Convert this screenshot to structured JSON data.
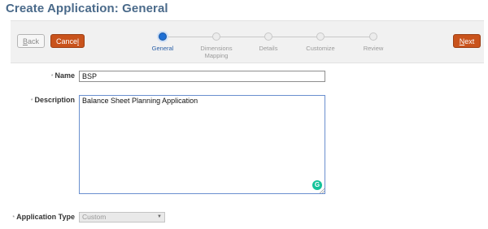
{
  "page": {
    "title": "Create Application: General"
  },
  "toolbar": {
    "back_label": "Back",
    "back_underline": "B",
    "back_rest": "ack",
    "cancel_pre": "Cance",
    "cancel_underline": "l",
    "next_label": "Next",
    "next_underline": "N",
    "next_rest": "ext"
  },
  "train": {
    "steps": [
      {
        "label": "General",
        "state": "current"
      },
      {
        "label": "Dimensions Mapping",
        "line1": "Dimensions",
        "line2": "Mapping",
        "state": "disabled"
      },
      {
        "label": "Details",
        "state": "disabled"
      },
      {
        "label": "Customize",
        "state": "disabled"
      },
      {
        "label": "Review",
        "state": "disabled"
      }
    ]
  },
  "form": {
    "required_marker": "*",
    "name": {
      "label": "Name",
      "value": "BSP"
    },
    "description": {
      "label": "Description",
      "value": "Balance Sheet Planning Application"
    },
    "app_type": {
      "label": "Application Type",
      "value": "Custom"
    }
  },
  "icons": {
    "grammarly": "grammarly-icon",
    "dropdown": "chevron-down-icon",
    "resize": "resize-grip-icon"
  },
  "colors": {
    "accent": "#c9531c",
    "title": "#4a6a8a",
    "active_step": "#1e6fd4"
  }
}
